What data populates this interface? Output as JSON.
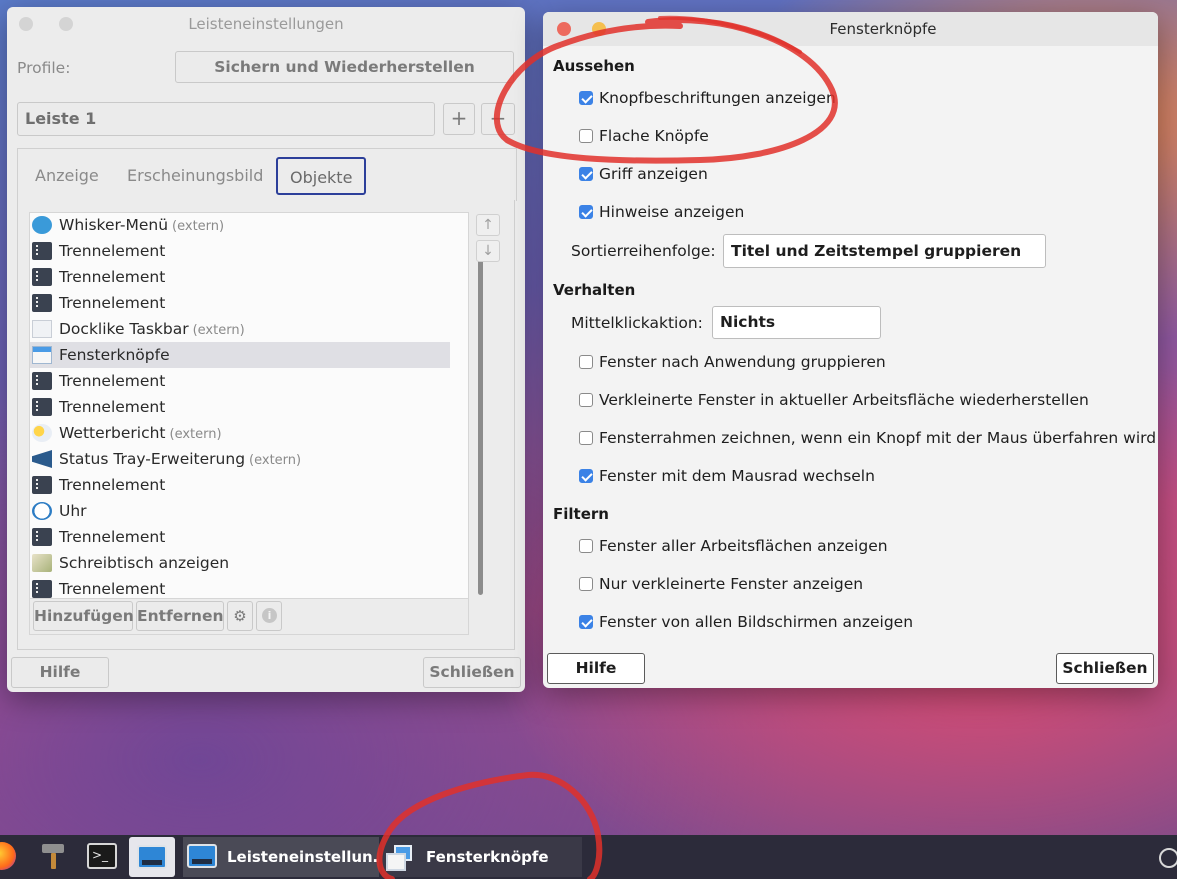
{
  "left_window": {
    "title": "Leisteneinstellungen",
    "profile_label": "Profile:",
    "backup_button": "Sichern und Wiederherstellen",
    "panel_select": "Leiste 1",
    "add_panel": "+",
    "remove_panel": "−",
    "tabs": [
      "Anzeige",
      "Erscheinungsbild",
      "Objekte"
    ],
    "items": [
      {
        "label": "Whisker-Menü",
        "extern": "(extern)",
        "icon": "whisker-menu-icon"
      },
      {
        "label": "Trennelement",
        "extern": "",
        "icon": "separator-icon"
      },
      {
        "label": "Trennelement",
        "extern": "",
        "icon": "separator-icon"
      },
      {
        "label": "Trennelement",
        "extern": "",
        "icon": "separator-icon"
      },
      {
        "label": "Docklike Taskbar",
        "extern": "(extern)",
        "icon": "taskbar-icon"
      },
      {
        "label": "Fensterknöpfe",
        "extern": "",
        "icon": "windows-icon"
      },
      {
        "label": "Trennelement",
        "extern": "",
        "icon": "separator-icon"
      },
      {
        "label": "Trennelement",
        "extern": "",
        "icon": "separator-icon"
      },
      {
        "label": "Wetterbericht",
        "extern": "(extern)",
        "icon": "weather-icon"
      },
      {
        "label": "Status Tray-Erweiterung",
        "extern": "(extern)",
        "icon": "megaphone-icon"
      },
      {
        "label": "Trennelement",
        "extern": "",
        "icon": "separator-icon"
      },
      {
        "label": "Uhr",
        "extern": "",
        "icon": "clock-icon"
      },
      {
        "label": "Trennelement",
        "extern": "",
        "icon": "separator-icon"
      },
      {
        "label": "Schreibtisch anzeigen",
        "extern": "",
        "icon": "desktop-icon"
      },
      {
        "label": "Trennelement",
        "extern": "",
        "icon": "separator-icon"
      }
    ],
    "move_up": "↑",
    "move_down": "↓",
    "add_button": "Hinzufügen",
    "remove_button": "Entfernen",
    "help_button": "Hilfe",
    "close_button": "Schließen"
  },
  "right_window": {
    "title": "Fensterknöpfe",
    "sections": {
      "appearance": "Aussehen",
      "behavior": "Verhalten",
      "filter": "Filtern"
    },
    "appearance": [
      {
        "label": "Knopfbeschriftungen anzeigen",
        "checked": true
      },
      {
        "label": "Flache Knöpfe",
        "checked": false
      },
      {
        "label": "Griff anzeigen",
        "checked": true
      },
      {
        "label": "Hinweise anzeigen",
        "checked": true
      }
    ],
    "sort_label": "Sortierreihenfolge:",
    "sort_value": "Titel und Zeitstempel gruppieren",
    "middle_click_label": "Mittelklickaktion:",
    "middle_click_value": "Nichts",
    "behavior": [
      {
        "label": "Fenster nach Anwendung gruppieren",
        "checked": false
      },
      {
        "label": "Verkleinerte Fenster in aktueller Arbeitsfläche wiederherstellen",
        "checked": false
      },
      {
        "label": "Fensterrahmen zeichnen, wenn ein Knopf mit der Maus überfahren wird",
        "checked": false
      },
      {
        "label": "Fenster mit dem Mausrad wechseln",
        "checked": true
      }
    ],
    "filter": [
      {
        "label": "Fenster aller Arbeitsflächen anzeigen",
        "checked": false
      },
      {
        "label": "Nur verkleinerte Fenster anzeigen",
        "checked": false
      },
      {
        "label": "Fenster von allen Bildschirmen anzeigen",
        "checked": true
      }
    ],
    "help_button": "Hilfe",
    "close_button": "Schließen"
  },
  "taskbar": {
    "tasks": [
      {
        "label": "Leisteneinstellun…"
      },
      {
        "label": "Fensterknöpfe"
      }
    ]
  },
  "colors": {
    "checkbox_on": "#3b82e6",
    "active_tab_border": "#2c3f9a",
    "annotation": "#e0302a"
  }
}
